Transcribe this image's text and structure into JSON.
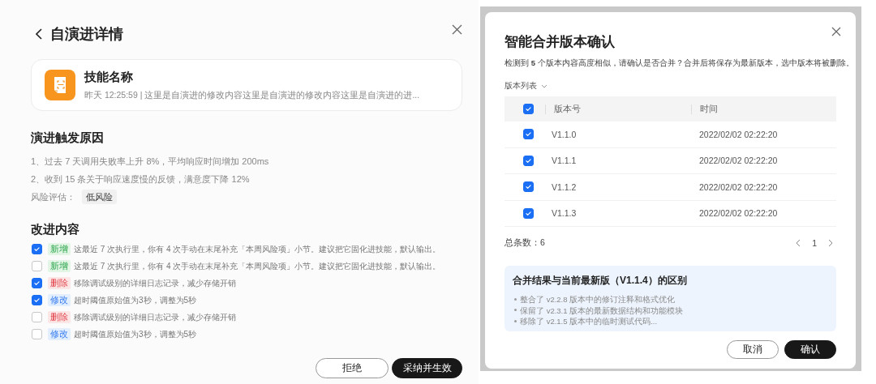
{
  "evolution_panel": {
    "title": "自演进详情",
    "skill": {
      "name": "技能名称",
      "time": "昨天 12:25:59",
      "separator": "|",
      "summary": "这里是自演进的修改内容这里是自演进的修改内容这里是自演进的进..."
    },
    "trigger": {
      "heading": "演进触发原因",
      "reasons": [
        "1、过去 7 天调用失败率上升 8%，平均响应时间增加 200ms",
        "2、收到 15 条关于响应速度慢的反馈，满意度下降 12%"
      ],
      "risk_label": "风险评估：",
      "risk_value": "低风险"
    },
    "improvements": {
      "heading": "改进内容",
      "items": [
        {
          "checked": true,
          "kind": "add",
          "tag": "新增",
          "text": "这最近 7 次执行里，你有 4 次手动在末尾补充「本周风险项」小节。建议把它固化进技能，默认输出。"
        },
        {
          "checked": false,
          "kind": "add",
          "tag": "新增",
          "text": "这最近 7 次执行里，你有 4 次手动在末尾补充「本周风险项」小节。建议把它固化进技能，默认输出。"
        },
        {
          "checked": true,
          "kind": "delete",
          "tag": "删除",
          "text": "移除调试级别的详细日志记录，减少存储开销"
        },
        {
          "checked": true,
          "kind": "modify",
          "tag": "修改",
          "text": "超时阈值原始值为3秒，调整为5秒"
        },
        {
          "checked": false,
          "kind": "delete",
          "tag": "删除",
          "text": "移除调试级别的详细日志记录，减少存储开销"
        },
        {
          "checked": false,
          "kind": "modify",
          "tag": "修改",
          "text": "超时阈值原始值为3秒，调整为5秒"
        }
      ]
    },
    "buttons": [
      {
        "label": "拒绝",
        "kind": "secondary"
      },
      {
        "label": "采纳并生效",
        "kind": "primary"
      }
    ]
  },
  "merge_dialog": {
    "title": "智能合并版本确认",
    "description": "检测到 **5** 个版本内容高度相似，请确认是否合并？合并后将保存为最新版本，选中版本将被删除。",
    "list_toggle": "版本列表",
    "table": {
      "all_checked": true,
      "columns": [
        "版本号",
        "时间"
      ],
      "rows": [
        {
          "checked": true,
          "version": "V1.1.0",
          "time": "2022/02/02 02:22:20"
        },
        {
          "checked": true,
          "version": "V1.1.1",
          "time": "2022/02/02 02:22:20"
        },
        {
          "checked": true,
          "version": "V1.1.2",
          "time": "2022/02/02 02:22:20"
        },
        {
          "checked": true,
          "version": "V1.1.3",
          "time": "2022/02/02 02:22:20"
        }
      ]
    },
    "total": "总条数：6",
    "page": "1",
    "diff": {
      "heading": "合并结果与当前最新版（V1.1.4）的区别",
      "items": [
        "整合了 v2.2.8 版本中的修订注释和格式优化",
        "保留了 v2.3.1 版本的最新数据结构和功能模块",
        "移除了 v2.1.5 版本中的临时测试代码..."
      ]
    },
    "buttons": [
      {
        "label": "取消",
        "kind": "secondary"
      },
      {
        "label": "确认",
        "kind": "primary"
      }
    ]
  }
}
